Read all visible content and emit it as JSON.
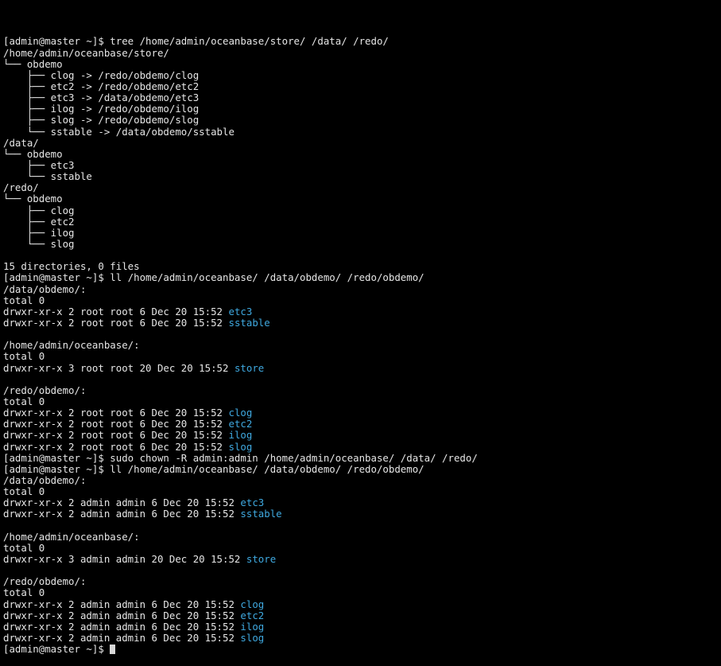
{
  "terminal": {
    "prompt_final": "[admin@master ~]$ ",
    "lines": [
      {
        "text": "[admin@master ~]$ tree /home/admin/oceanbase/store/ /data/ /redo/",
        "dir": ""
      },
      {
        "text": "/home/admin/oceanbase/store/",
        "dir": ""
      },
      {
        "text": "└── obdemo",
        "dir": ""
      },
      {
        "text": "    ├── clog -> /redo/obdemo/clog",
        "dir": ""
      },
      {
        "text": "    ├── etc2 -> /redo/obdemo/etc2",
        "dir": ""
      },
      {
        "text": "    ├── etc3 -> /data/obdemo/etc3",
        "dir": ""
      },
      {
        "text": "    ├── ilog -> /redo/obdemo/ilog",
        "dir": ""
      },
      {
        "text": "    ├── slog -> /redo/obdemo/slog",
        "dir": ""
      },
      {
        "text": "    └── sstable -> /data/obdemo/sstable",
        "dir": ""
      },
      {
        "text": "/data/",
        "dir": ""
      },
      {
        "text": "└── obdemo",
        "dir": ""
      },
      {
        "text": "    ├── etc3",
        "dir": ""
      },
      {
        "text": "    └── sstable",
        "dir": ""
      },
      {
        "text": "/redo/",
        "dir": ""
      },
      {
        "text": "└── obdemo",
        "dir": ""
      },
      {
        "text": "    ├── clog",
        "dir": ""
      },
      {
        "text": "    ├── etc2",
        "dir": ""
      },
      {
        "text": "    ├── ilog",
        "dir": ""
      },
      {
        "text": "    └── slog",
        "dir": ""
      },
      {
        "text": "",
        "dir": ""
      },
      {
        "text": "15 directories, 0 files",
        "dir": ""
      },
      {
        "text": "[admin@master ~]$ ll /home/admin/oceanbase/ /data/obdemo/ /redo/obdemo/",
        "dir": ""
      },
      {
        "text": "/data/obdemo/:",
        "dir": ""
      },
      {
        "text": "total 0",
        "dir": ""
      },
      {
        "text": "drwxr-xr-x 2 root root 6 Dec 20 15:52 ",
        "dir": "etc3"
      },
      {
        "text": "drwxr-xr-x 2 root root 6 Dec 20 15:52 ",
        "dir": "sstable"
      },
      {
        "text": "",
        "dir": ""
      },
      {
        "text": "/home/admin/oceanbase/:",
        "dir": ""
      },
      {
        "text": "total 0",
        "dir": ""
      },
      {
        "text": "drwxr-xr-x 3 root root 20 Dec 20 15:52 ",
        "dir": "store"
      },
      {
        "text": "",
        "dir": ""
      },
      {
        "text": "/redo/obdemo/:",
        "dir": ""
      },
      {
        "text": "total 0",
        "dir": ""
      },
      {
        "text": "drwxr-xr-x 2 root root 6 Dec 20 15:52 ",
        "dir": "clog"
      },
      {
        "text": "drwxr-xr-x 2 root root 6 Dec 20 15:52 ",
        "dir": "etc2"
      },
      {
        "text": "drwxr-xr-x 2 root root 6 Dec 20 15:52 ",
        "dir": "ilog"
      },
      {
        "text": "drwxr-xr-x 2 root root 6 Dec 20 15:52 ",
        "dir": "slog"
      },
      {
        "text": "[admin@master ~]$ sudo chown -R admin:admin /home/admin/oceanbase/ /data/ /redo/",
        "dir": ""
      },
      {
        "text": "[admin@master ~]$ ll /home/admin/oceanbase/ /data/obdemo/ /redo/obdemo/",
        "dir": ""
      },
      {
        "text": "/data/obdemo/:",
        "dir": ""
      },
      {
        "text": "total 0",
        "dir": ""
      },
      {
        "text": "drwxr-xr-x 2 admin admin 6 Dec 20 15:52 ",
        "dir": "etc3"
      },
      {
        "text": "drwxr-xr-x 2 admin admin 6 Dec 20 15:52 ",
        "dir": "sstable"
      },
      {
        "text": "",
        "dir": ""
      },
      {
        "text": "/home/admin/oceanbase/:",
        "dir": ""
      },
      {
        "text": "total 0",
        "dir": ""
      },
      {
        "text": "drwxr-xr-x 3 admin admin 20 Dec 20 15:52 ",
        "dir": "store"
      },
      {
        "text": "",
        "dir": ""
      },
      {
        "text": "/redo/obdemo/:",
        "dir": ""
      },
      {
        "text": "total 0",
        "dir": ""
      },
      {
        "text": "drwxr-xr-x 2 admin admin 6 Dec 20 15:52 ",
        "dir": "clog"
      },
      {
        "text": "drwxr-xr-x 2 admin admin 6 Dec 20 15:52 ",
        "dir": "etc2"
      },
      {
        "text": "drwxr-xr-x 2 admin admin 6 Dec 20 15:52 ",
        "dir": "ilog"
      },
      {
        "text": "drwxr-xr-x 2 admin admin 6 Dec 20 15:52 ",
        "dir": "slog"
      }
    ]
  },
  "colors": {
    "background": "#000000",
    "foreground": "#e6e6e6",
    "directory": "#3fa9e0",
    "cursor": "#d8d8d8"
  }
}
